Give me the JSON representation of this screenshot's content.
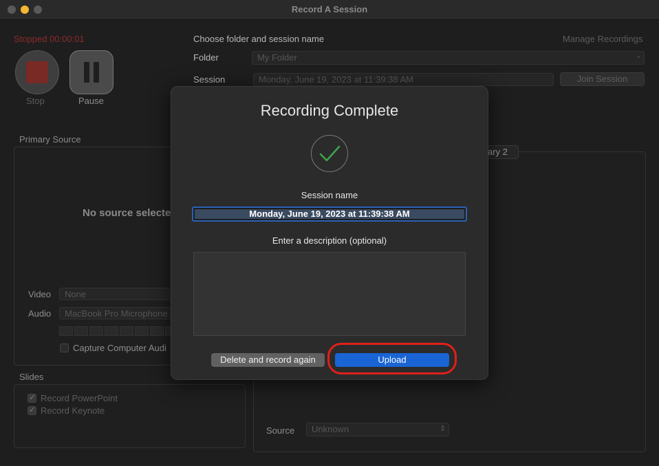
{
  "window": {
    "title": "Record A Session"
  },
  "recorder": {
    "status": "Stopped 00:00:01",
    "stop_label": "Stop",
    "pause_label": "Pause"
  },
  "session_setup": {
    "heading": "Choose folder and session name",
    "manage_link": "Manage Recordings",
    "folder_label": "Folder",
    "folder_value": "My Folder",
    "session_label": "Session",
    "session_value": "Monday, June 19, 2023 at 11:39:38 AM",
    "join_button": "Join Session"
  },
  "primary_source": {
    "heading": "Primary Source",
    "placeholder": "No source selecte",
    "video_label": "Video",
    "video_value": "None",
    "audio_label": "Audio",
    "audio_value": "MacBook Pro Microphone",
    "capture_audio_label": "Capture Computer Audi"
  },
  "secondary": {
    "tab_label": "ary 2",
    "source_label": "Source",
    "source_value": "Unknown"
  },
  "slides": {
    "heading": "Slides",
    "powerpoint_label": "Record PowerPoint",
    "keynote_label": "Record Keynote"
  },
  "modal": {
    "title": "Recording Complete",
    "session_name_label": "Session name",
    "session_name_value": "Monday, June 19, 2023 at 11:39:38 AM",
    "description_label": "Enter a description (optional)",
    "delete_button": "Delete and record again",
    "upload_button": "Upload"
  },
  "colors": {
    "accent": "#1a64d6",
    "highlight": "#e0201a",
    "success": "#3fa34d"
  }
}
